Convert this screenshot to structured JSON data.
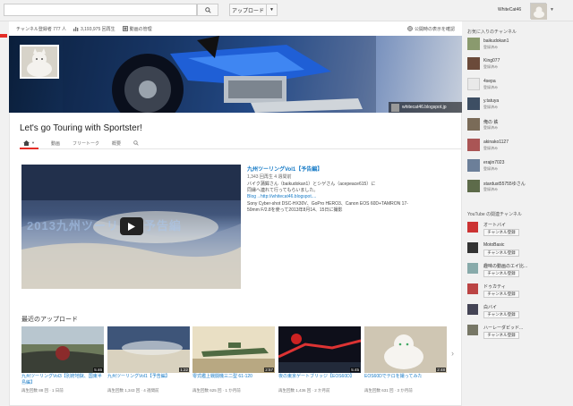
{
  "header": {
    "upload_label": "アップロード",
    "username": "WhiteCat46"
  },
  "stats": {
    "subscribers": "チャンネル登録者 777 人",
    "views": "3,193,975 回再生",
    "manage": "動画の管理",
    "public_view": "公開時の表示を確認"
  },
  "banner": {
    "blog_tag": "whitecat46.blogspot.jp"
  },
  "channel": {
    "title": "Let's go Touring with Sportster!"
  },
  "tabs": [
    {
      "label": "動画"
    },
    {
      "label": "フリートーク"
    },
    {
      "label": "概要"
    }
  ],
  "featured": {
    "overlay_text": "2013九州ツーリング予告編",
    "title": "九州ツーリングVol1【予告編】",
    "meta": "1,343 回再生 4 週間前",
    "desc1": "バイク蒲鉾さん（baikudokan1）とシゲさん（acepeace615）に",
    "desc2": "同縁へ連れて行ってもらいました。",
    "desc3": "Blog→http://whitecat46.blogspot....",
    "desc4": "Sony Cyber-shot DSC-HX30V、GoPro HERO3、Canon EOS 60D+TAMRON 17-",
    "desc5": "50mm F/2.8を使って2013年8月14、15日に撮影"
  },
  "recent": {
    "title": "最近のアップロード",
    "videos": [
      {
        "title": "九州ツーリングVol3【別府地獄、国東半島編】",
        "duration": "5:46",
        "meta": "再生回数 88 回",
        "ago": "1 日前"
      },
      {
        "title": "九州ツーリングVol1【予告編】",
        "duration": "1:22",
        "meta": "再生回数 1,343 回",
        "ago": "4 週間前"
      },
      {
        "title": "零式艦上戦闘機三二型 61-120",
        "duration": "2:57",
        "meta": "再生回数 625 回",
        "ago": "1 か月前"
      },
      {
        "title": "夜の東京ゲートブリッジ【EOS60D】",
        "duration": "5:45",
        "meta": "再生回数 1,436 回",
        "ago": "2 か月前"
      },
      {
        "title": "EOS60Dでテロを撮ってみた",
        "duration": "2:48",
        "meta": "再生回数 631 回",
        "ago": "3 か月前"
      }
    ]
  },
  "sidebar": {
    "fav_heading": "お気に入りのチャンネル",
    "favorites": [
      {
        "name": "baikudokan1",
        "status": "登録済み"
      },
      {
        "name": "King077",
        "status": "登録済み"
      },
      {
        "name": "4sepa",
        "status": "登録済み"
      },
      {
        "name": "y.tatuya",
        "status": "登録済み"
      },
      {
        "name": "俺の 鉄",
        "status": "登録済み"
      },
      {
        "name": "akinako1127",
        "status": "登録済み"
      },
      {
        "name": "erajin7023",
        "status": "登録済み"
      },
      {
        "name": "stardust55755ゆさん",
        "status": "登録済み"
      }
    ],
    "rel_heading": "YouTube の関連チャンネル",
    "related": [
      {
        "name": "オートバイ",
        "button": "チャンネル登録"
      },
      {
        "name": "MotoBasic",
        "button": "チャンネル登録"
      },
      {
        "name": "趣味の動画のエイ比...",
        "button": "チャンネル登録"
      },
      {
        "name": "ドゥカティ",
        "button": "チャンネル登録"
      },
      {
        "name": "白バイ",
        "button": "チャンネル登録"
      },
      {
        "name": "ハーレーダビッド...",
        "button": "チャンネル登録"
      }
    ]
  }
}
